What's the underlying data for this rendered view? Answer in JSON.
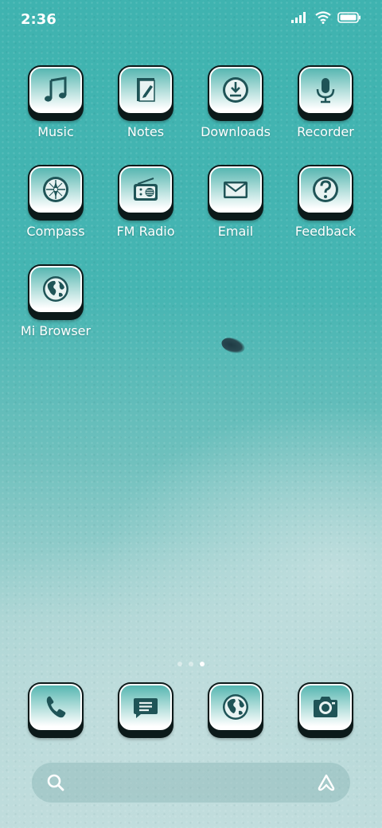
{
  "status_bar": {
    "time": "2:36",
    "icons": [
      "signal-icon",
      "wifi-icon",
      "battery-icon"
    ]
  },
  "apps": [
    {
      "label": "Music",
      "icon": "music-note-icon"
    },
    {
      "label": "Notes",
      "icon": "notes-icon"
    },
    {
      "label": "Downloads",
      "icon": "download-icon"
    },
    {
      "label": "Recorder",
      "icon": "microphone-icon"
    },
    {
      "label": "Compass",
      "icon": "compass-icon"
    },
    {
      "label": "FM Radio",
      "icon": "radio-icon"
    },
    {
      "label": "Email",
      "icon": "envelope-icon"
    },
    {
      "label": "Feedback",
      "icon": "question-icon"
    },
    {
      "label": "Mi Browser",
      "icon": "globe-icon"
    }
  ],
  "dock": [
    {
      "icon": "phone-icon"
    },
    {
      "icon": "message-icon"
    },
    {
      "icon": "globe-icon"
    },
    {
      "icon": "camera-icon"
    }
  ],
  "page_indicator": {
    "count": 3,
    "active": 3
  },
  "search_bar": {
    "left_icon": "search-icon",
    "right_icon": "assistant-icon"
  },
  "colors": {
    "wallpaper_top": "#3fb3b0",
    "wallpaper_bottom": "#bfdcdc",
    "icon_glyph": "#1f5457",
    "icon_border": "#0c1a1a"
  }
}
